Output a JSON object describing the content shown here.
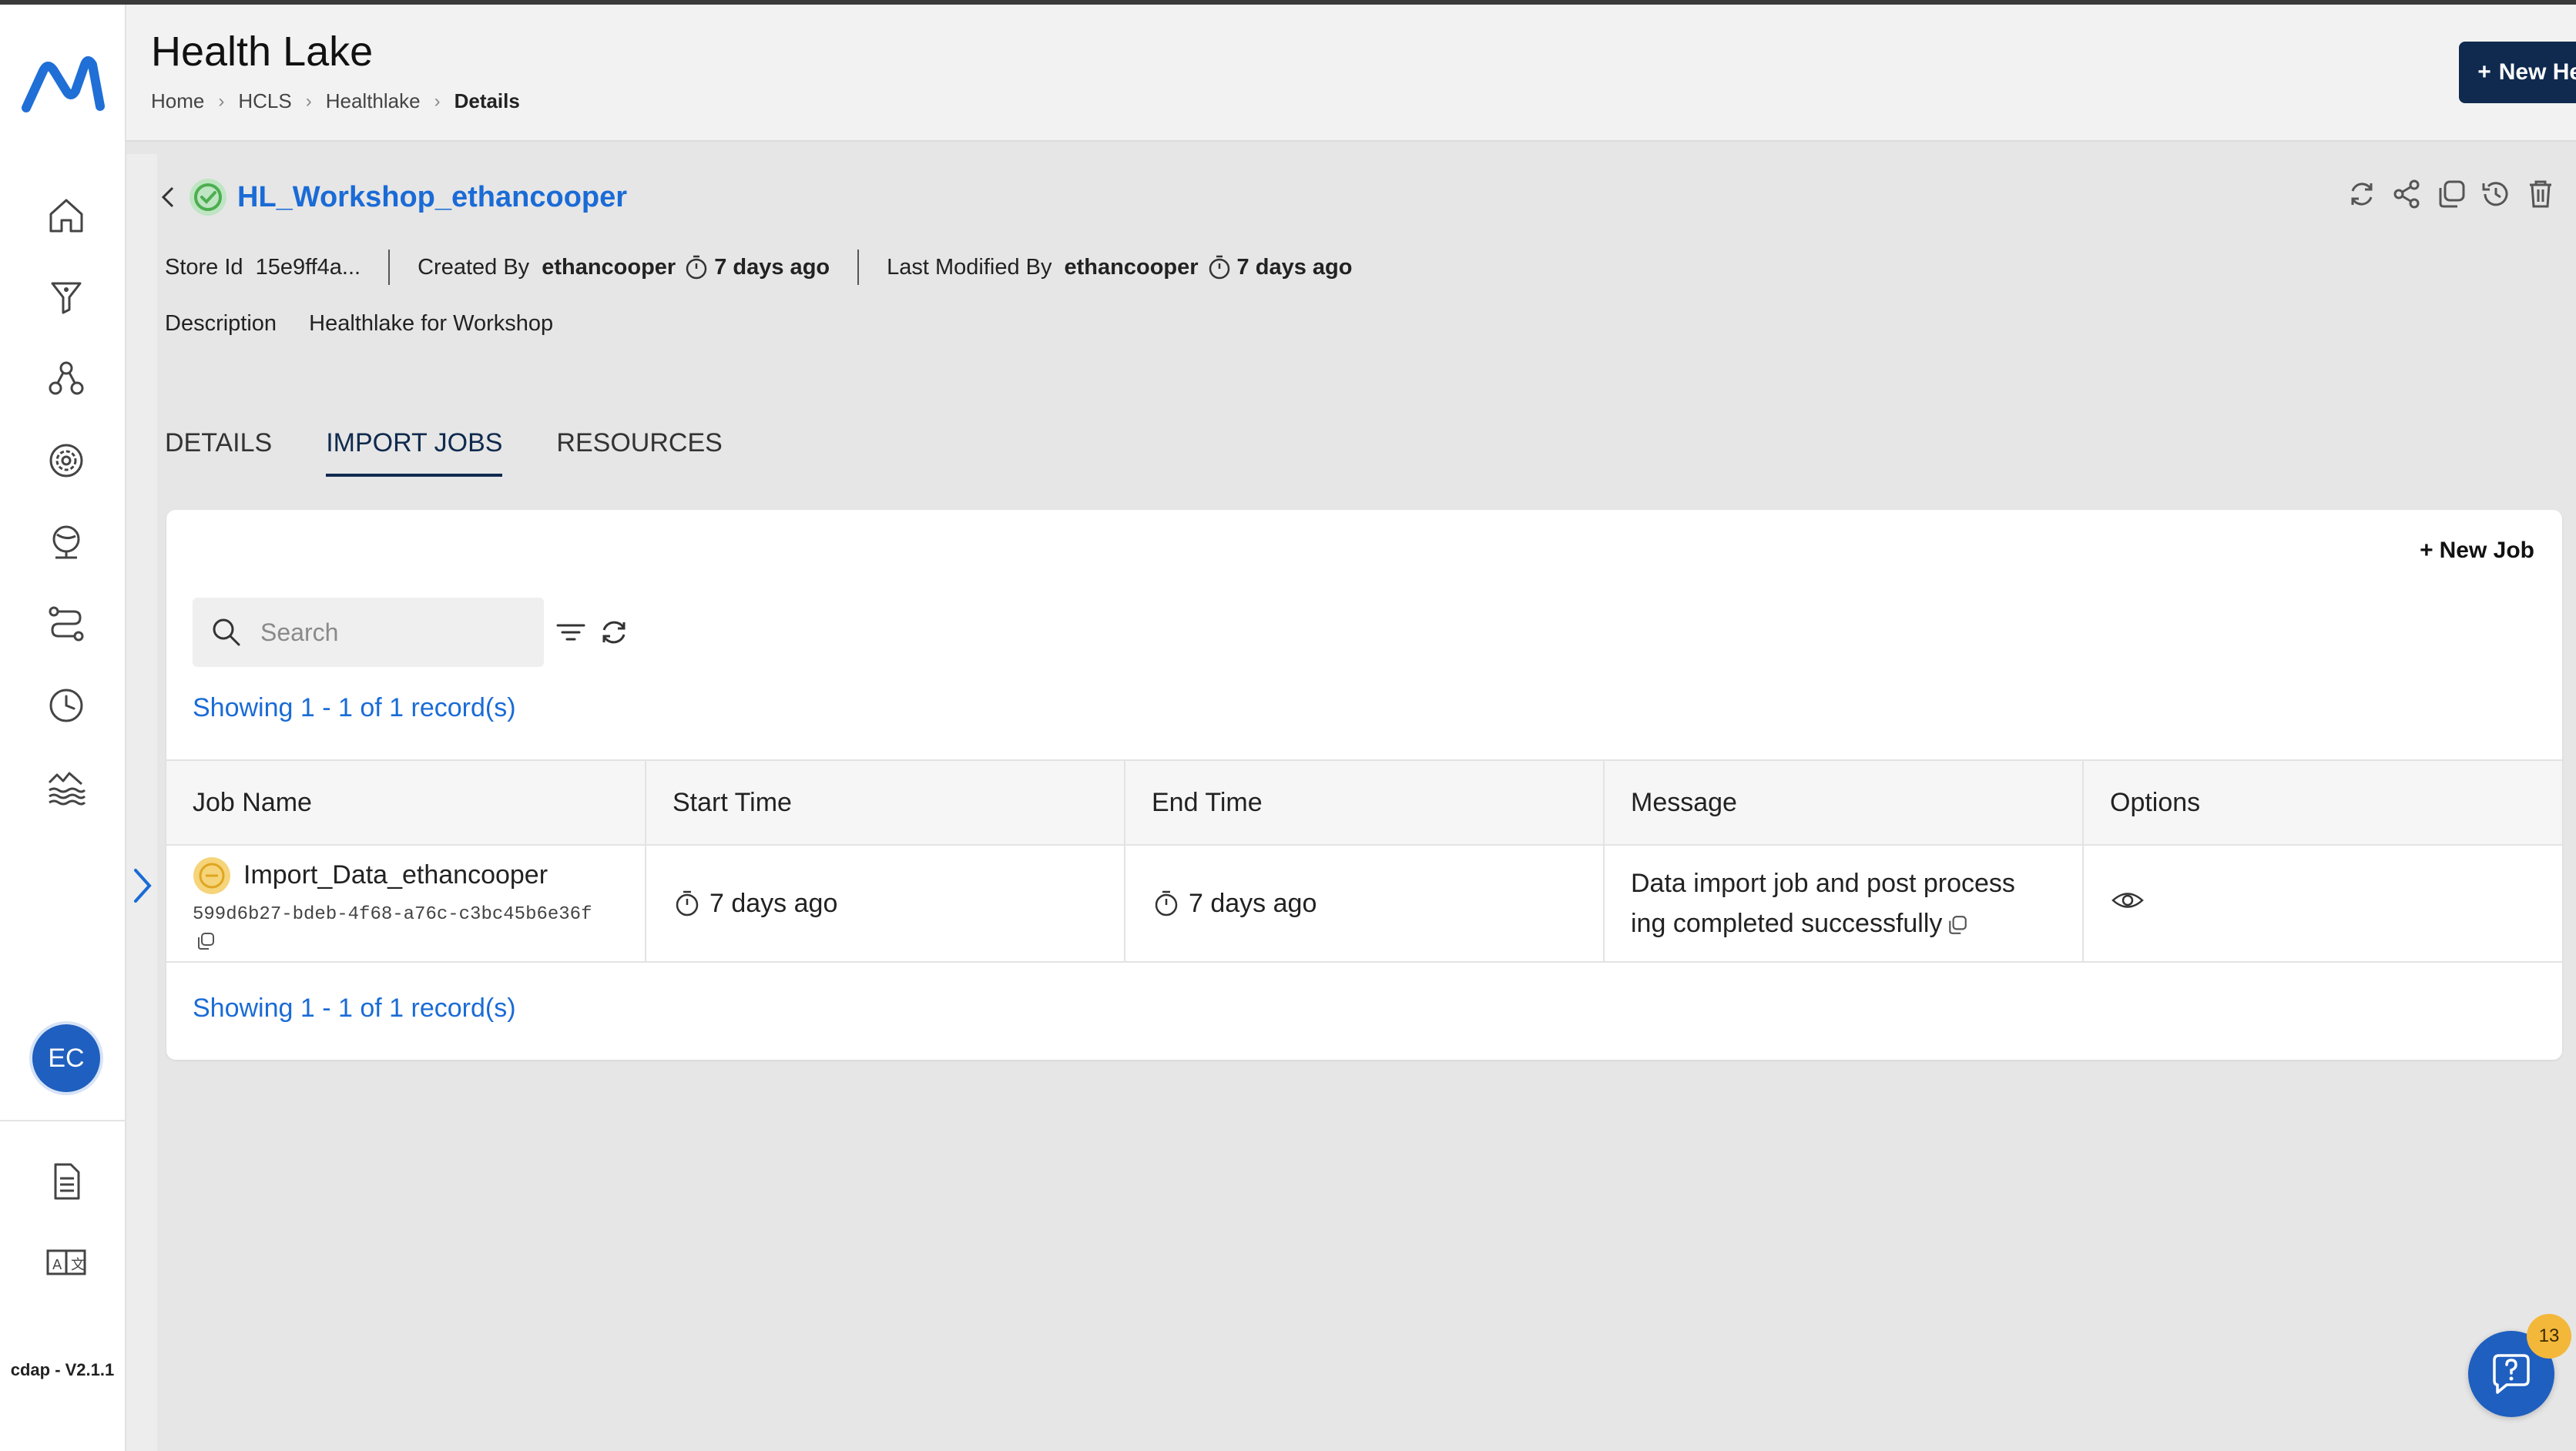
{
  "header": {
    "title": "Health Lake",
    "breadcrumb": [
      "Home",
      "HCLS",
      "Healthlake",
      "Details"
    ],
    "new_button": "New Healthlake"
  },
  "sidebar": {
    "items": [
      "home-icon",
      "funnel-icon",
      "network-icon",
      "gear-target-icon",
      "globe-icon",
      "pipeline-icon",
      "clock-icon",
      "lake-icon"
    ],
    "avatar": "EC",
    "bottom_items": [
      "document-icon",
      "translate-icon"
    ],
    "version": "cdap - V2.1.1"
  },
  "store": {
    "name": "HL_Workshop_ethancooper",
    "store_id_label": "Store Id",
    "store_id": "15e9ff4a...",
    "created_by_label": "Created By",
    "created_by": "ethancooper",
    "created_ago": "7 days ago",
    "modified_by_label": "Last Modified By",
    "modified_by": "ethancooper",
    "modified_ago": "7 days ago",
    "description_label": "Description",
    "description": "Healthlake for Workshop"
  },
  "tabs": [
    {
      "label": "DETAILS",
      "active": false
    },
    {
      "label": "IMPORT JOBS",
      "active": true
    },
    {
      "label": "RESOURCES",
      "active": false
    }
  ],
  "jobs": {
    "new_job": "New Job",
    "search_placeholder": "Search",
    "showing": "Showing 1 - 1 of 1 record(s)",
    "columns": [
      "Job Name",
      "Start Time",
      "End Time",
      "Message",
      "Options"
    ],
    "rows": [
      {
        "name": "Import_Data_ethancooper",
        "id": "599d6b27-bdeb-4f68-a76c-c3bc45b6e36f",
        "start": "7 days ago",
        "end": "7 days ago",
        "message_line1": "Data import job and post process",
        "message_line2": "ing completed successfully"
      }
    ]
  },
  "help": {
    "badge": "13"
  },
  "colors": {
    "primary": "#0f2a4e",
    "link": "#1a6bd6",
    "success": "#4caf50",
    "warning": "#f3b73a"
  }
}
